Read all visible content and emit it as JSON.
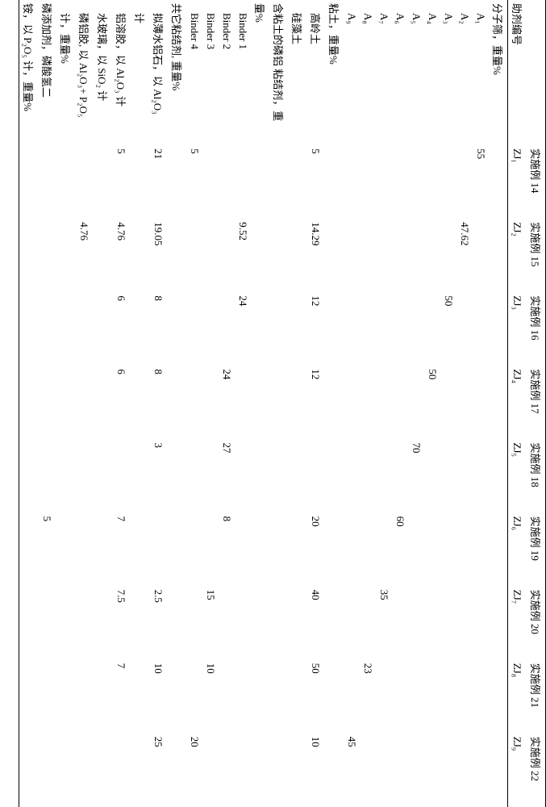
{
  "chart_data": {
    "type": "table",
    "columns": [
      "实施例 14",
      "实施例 15",
      "实施例 16",
      "实施例 17",
      "实施例 18",
      "实施例 19",
      "实施例 20",
      "实施例 21",
      "实施例 22"
    ],
    "row_labels": [
      "助剂编号",
      "分子筛，重量%",
      "A₁",
      "A₂",
      "A₃",
      "A₄",
      "A₅",
      "A₆",
      "A₇",
      "A₈",
      "A₉",
      "粘土，重量%",
      "高岭土",
      "硅藻土",
      "含粘土的磷铝 粘结剂，重 量%",
      "Binder 1",
      "Binder 2",
      "Binder 3",
      "Binder 4",
      "共它粘结剂, 重量%",
      "拟薄水铝石，以 Al₂O₃ 计",
      "铝溶胶，以 Al₂O₃ 计",
      "水玻璃，以 SiO₂ 计",
      "磷铝胶, 以 Al₂O₃+ P₂O₅ 计，重量%",
      "磷添加剂，磷酸氢二铵，以 P₂O₅ 计，重量%"
    ],
    "data": [
      [
        "ZJ₁",
        "ZJ₂",
        "ZJ₃",
        "ZJ₄",
        "ZJ₅",
        "ZJ₆",
        "ZJ₇",
        "ZJ₈",
        "ZJ₉"
      ],
      [
        "",
        "",
        "",
        "",
        "",
        "",
        "",
        "",
        ""
      ],
      [
        "55",
        "",
        "",
        "",
        "",
        "",
        "",
        "",
        ""
      ],
      [
        "",
        "47.62",
        "",
        "",
        "",
        "",
        "",
        "",
        ""
      ],
      [
        "",
        "",
        "50",
        "",
        "",
        "",
        "",
        "",
        ""
      ],
      [
        "",
        "",
        "",
        "50",
        "",
        "",
        "",
        "",
        ""
      ],
      [
        "",
        "",
        "",
        "",
        "70",
        "",
        "",
        "",
        ""
      ],
      [
        "",
        "",
        "",
        "",
        "",
        "60",
        "",
        "",
        ""
      ],
      [
        "",
        "",
        "",
        "",
        "",
        "",
        "35",
        "",
        ""
      ],
      [
        "",
        "",
        "",
        "",
        "",
        "",
        "",
        "23",
        ""
      ],
      [
        "",
        "",
        "",
        "",
        "",
        "",
        "",
        "",
        "45"
      ],
      [
        "",
        "",
        "",
        "",
        "",
        "",
        "",
        "",
        ""
      ],
      [
        "5",
        "14.29",
        "12",
        "12",
        "",
        "20",
        "40",
        "50",
        "10"
      ],
      [
        "",
        "",
        "",
        "",
        "",
        "",
        "",
        "",
        ""
      ],
      [
        "",
        "",
        "",
        "",
        "",
        "",
        "",
        "",
        ""
      ],
      [
        "",
        "9.52",
        "24",
        "",
        "",
        "",
        "",
        "",
        ""
      ],
      [
        "",
        "",
        "",
        "24",
        "27",
        "8",
        "",
        "",
        ""
      ],
      [
        "",
        "",
        "",
        "",
        "",
        "",
        "15",
        "10",
        ""
      ],
      [
        "5",
        "",
        "",
        "",
        "",
        "",
        "",
        "",
        "20"
      ],
      [
        "",
        "",
        "",
        "",
        "",
        "",
        "",
        "",
        ""
      ],
      [
        "21",
        "19.05",
        "8",
        "8",
        "3",
        "",
        "2.5",
        "10",
        "25"
      ],
      [
        "5",
        "4.76",
        "6",
        "6",
        "",
        "7",
        "7.5",
        "7",
        ""
      ],
      [
        "",
        "",
        "",
        "",
        "",
        "",
        "",
        "",
        ""
      ],
      [
        "",
        "4.76",
        "",
        "",
        "",
        "",
        "",
        "",
        ""
      ],
      [
        "",
        "",
        "",
        "",
        "",
        "5",
        "",
        "",
        ""
      ]
    ]
  },
  "cols": [
    {
      "ex": "实施例 14",
      "id": "ZJ₁"
    },
    {
      "ex": "实施例 15",
      "id": "ZJ₂"
    },
    {
      "ex": "实施例 16",
      "id": "ZJ₃"
    },
    {
      "ex": "实施例 17",
      "id": "ZJ₄"
    },
    {
      "ex": "实施例 18",
      "id": "ZJ₅"
    },
    {
      "ex": "实施例 19",
      "id": "ZJ₆"
    },
    {
      "ex": "实施例 20",
      "id": "ZJ₇"
    },
    {
      "ex": "实施例 21",
      "id": "ZJ₈"
    },
    {
      "ex": "实施例 22",
      "id": "ZJ₉"
    }
  ],
  "rows": [
    {
      "k": "r_aid_no",
      "label": "助剂编号",
      "type": "id",
      "class": ""
    },
    {
      "k": "r_ms_head",
      "label": "分子筛，重量%",
      "type": "head",
      "class": ""
    },
    {
      "k": "r_a1",
      "label": "A₁",
      "type": "data",
      "class": "indent1",
      "v": [
        "55",
        "",
        "",
        "",
        "",
        "",
        "",
        "",
        ""
      ]
    },
    {
      "k": "r_a2",
      "label": "A₂",
      "type": "data",
      "class": "indent1",
      "v": [
        "",
        "47.62",
        "",
        "",
        "",
        "",
        "",
        "",
        ""
      ]
    },
    {
      "k": "r_a3",
      "label": "A₃",
      "type": "data",
      "class": "indent1",
      "v": [
        "",
        "",
        "50",
        "",
        "",
        "",
        "",
        "",
        ""
      ]
    },
    {
      "k": "r_a4",
      "label": "A₄",
      "type": "data",
      "class": "indent1",
      "v": [
        "",
        "",
        "",
        "50",
        "",
        "",
        "",
        "",
        ""
      ]
    },
    {
      "k": "r_a5",
      "label": "A₅",
      "type": "data",
      "class": "indent1",
      "v": [
        "",
        "",
        "",
        "",
        "70",
        "",
        "",
        "",
        ""
      ]
    },
    {
      "k": "r_a6",
      "label": "A₆",
      "type": "data",
      "class": "indent1",
      "v": [
        "",
        "",
        "",
        "",
        "",
        "60",
        "",
        "",
        ""
      ]
    },
    {
      "k": "r_a7",
      "label": "A₇",
      "type": "data",
      "class": "indent1",
      "v": [
        "",
        "",
        "",
        "",
        "",
        "",
        "35",
        "",
        ""
      ]
    },
    {
      "k": "r_a8",
      "label": "A₈",
      "type": "data",
      "class": "indent1",
      "v": [
        "",
        "",
        "",
        "",
        "",
        "",
        "",
        "23",
        ""
      ]
    },
    {
      "k": "r_a9",
      "label": "A₉",
      "type": "data",
      "class": "indent1",
      "v": [
        "",
        "",
        "",
        "",
        "",
        "",
        "",
        "",
        "45"
      ]
    },
    {
      "k": "r_clay_head",
      "label": "粘土，重量%",
      "type": "head",
      "class": ""
    },
    {
      "k": "r_kaolin",
      "label": "高岭土",
      "type": "data",
      "class": "indent1",
      "v": [
        "5",
        "14.29",
        "12",
        "12",
        "",
        "20",
        "40",
        "50",
        "10"
      ]
    },
    {
      "k": "r_diatom",
      "label": "硅藻土",
      "type": "data",
      "class": "indent1",
      "v": [
        "",
        "",
        "",
        "",
        "",
        "",
        "",
        "",
        ""
      ]
    },
    {
      "k": "r_pal_head",
      "label": "含粘土的磷铝 粘结剂，重",
      "type": "head",
      "class": ""
    },
    {
      "k": "r_pal_head2",
      "label": "量%",
      "type": "head",
      "class": ""
    },
    {
      "k": "r_b1",
      "label": "Binder 1",
      "type": "data",
      "class": "indent1",
      "v": [
        "",
        "9.52",
        "24",
        "",
        "",
        "",
        "",
        "",
        ""
      ]
    },
    {
      "k": "r_b2",
      "label": "Binder 2",
      "type": "data",
      "class": "indent1",
      "v": [
        "",
        "",
        "",
        "24",
        "27",
        "8",
        "",
        "",
        ""
      ]
    },
    {
      "k": "r_b3",
      "label": "Binder 3",
      "type": "data",
      "class": "indent1",
      "v": [
        "",
        "",
        "",
        "",
        "",
        "",
        "15",
        "10",
        ""
      ]
    },
    {
      "k": "r_b4",
      "label": "Binder 4",
      "type": "data",
      "class": "indent1",
      "v": [
        "5",
        "",
        "",
        "",
        "",
        "",
        "",
        "",
        "20"
      ]
    },
    {
      "k": "r_other_head",
      "label": "共它粘结剂, 重量%",
      "type": "head",
      "class": ""
    },
    {
      "k": "r_pbs1",
      "label": "拟薄水铝石，以 Al₂O₃",
      "type": "data",
      "class": "indent1",
      "v": [
        "21",
        "19.05",
        "8",
        "8",
        "3",
        "",
        "2.5",
        "10",
        "25"
      ]
    },
    {
      "k": "r_pbs2",
      "label": "计",
      "type": "cont",
      "class": "indent1"
    },
    {
      "k": "r_alsol",
      "label": "铝溶胶，以 Al₂O₃ 计",
      "type": "data",
      "class": "indent1",
      "v": [
        "5",
        "4.76",
        "6",
        "6",
        "",
        "7",
        "7.5",
        "7",
        ""
      ]
    },
    {
      "k": "r_wglass",
      "label": "水玻璃，以 SiO₂ 计",
      "type": "data",
      "class": "indent1",
      "v": [
        "",
        "",
        "",
        "",
        "",
        "",
        "",
        "",
        ""
      ]
    },
    {
      "k": "r_palj1",
      "label": "磷铝胶, 以 Al₂O₃+ P₂O₅",
      "type": "data",
      "class": "indent1",
      "v": [
        "",
        "4.76",
        "",
        "",
        "",
        "",
        "",
        "",
        ""
      ]
    },
    {
      "k": "r_palj2",
      "label": "计，重量%",
      "type": "cont",
      "class": "indent1"
    },
    {
      "k": "r_padd1",
      "label": "磷添加剂，磷酸氢二",
      "type": "data",
      "class": "",
      "v": [
        "",
        "",
        "",
        "",
        "",
        "5",
        "",
        "",
        ""
      ]
    },
    {
      "k": "r_padd2",
      "label": "铵，以 P₂O₅ 计，重量%",
      "type": "cont",
      "class": ""
    }
  ]
}
